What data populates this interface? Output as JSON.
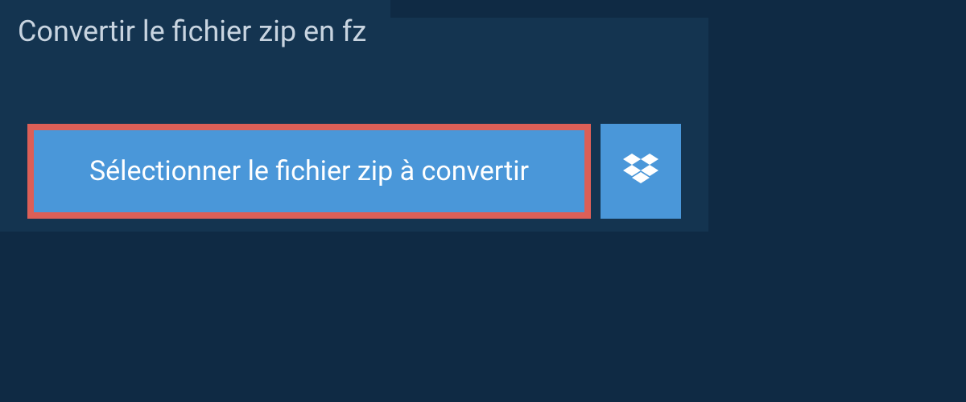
{
  "header": {
    "title": "Convertir le fichier zip en fz"
  },
  "actions": {
    "select_file_label": "Sélectionner le fichier zip à convertir"
  }
}
